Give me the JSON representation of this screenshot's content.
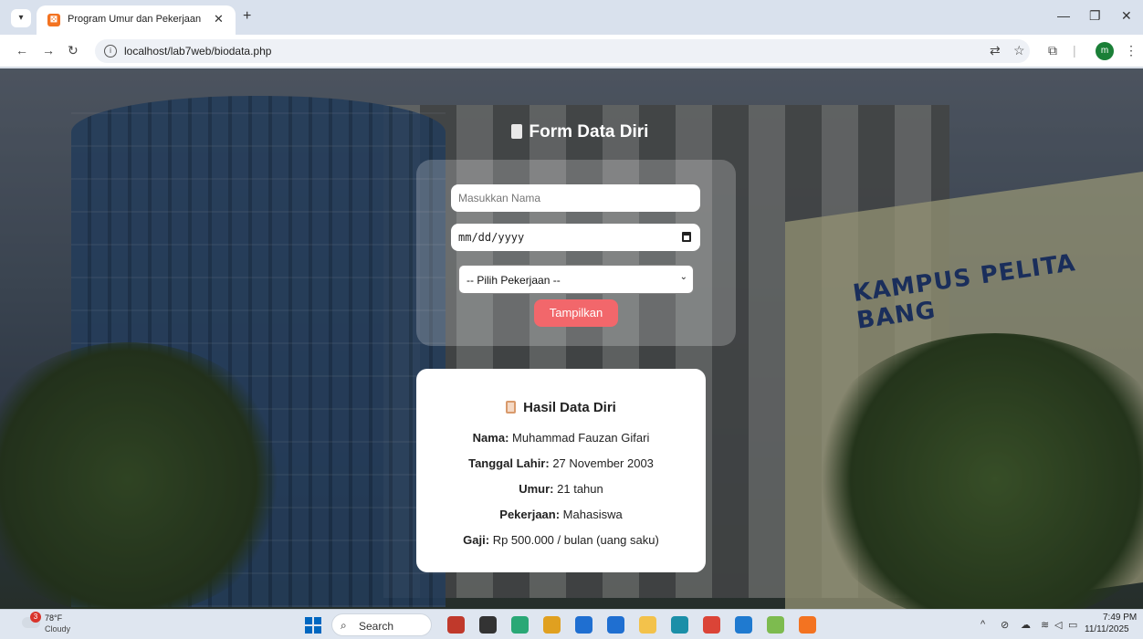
{
  "browser": {
    "tab_title": "Program Umur dan Pekerjaan",
    "tab_favicon": "xampp-icon",
    "url": "localhost/lab7web/biodata.php",
    "profile_initial": "m"
  },
  "form": {
    "title": "Form Data Diri",
    "name_placeholder": "Masukkan Nama",
    "date_placeholder": "mm/dd/yyyy",
    "job_select_value": "-- Pilih Pekerjaan --",
    "submit_label": "Tampilkan"
  },
  "result": {
    "title": "Hasil Data Diri",
    "rows": [
      {
        "label": "Nama:",
        "value": "Muhammad Fauzan Gifari"
      },
      {
        "label": "Tanggal Lahir:",
        "value": "27 November 2003"
      },
      {
        "label": "Umur:",
        "value": "21 tahun"
      },
      {
        "label": "Pekerjaan:",
        "value": "Mahasiswa"
      },
      {
        "label": "Gaji:",
        "value": "Rp 500.000 / bulan (uang saku)"
      }
    ]
  },
  "background": {
    "sign_text": "KAMPUS PELITA BANG"
  },
  "taskbar": {
    "weather_badge": "3",
    "temperature": "78°F",
    "condition": "Cloudy",
    "search_label": "Search",
    "time": "7:49 PM",
    "date": "11/11/2025",
    "apps": [
      {
        "name": "widgets-app",
        "color": "#c0392b"
      },
      {
        "name": "task-view-app",
        "color": "#333333"
      },
      {
        "name": "copilot-app",
        "color": "#2aa876"
      },
      {
        "name": "photos-app",
        "color": "#e0a020"
      },
      {
        "name": "store-app",
        "color": "#1f6fd1"
      },
      {
        "name": "teams-app",
        "color": "#1f6fd1"
      },
      {
        "name": "file-explorer-app",
        "color": "#f3c24b"
      },
      {
        "name": "edge-app",
        "color": "#1b8fa8"
      },
      {
        "name": "chrome-app",
        "color": "#db4437"
      },
      {
        "name": "vscode-app",
        "color": "#1f7ad0"
      },
      {
        "name": "paint-app",
        "color": "#7dbb4f"
      },
      {
        "name": "xampp-app",
        "color": "#f37321"
      }
    ]
  }
}
